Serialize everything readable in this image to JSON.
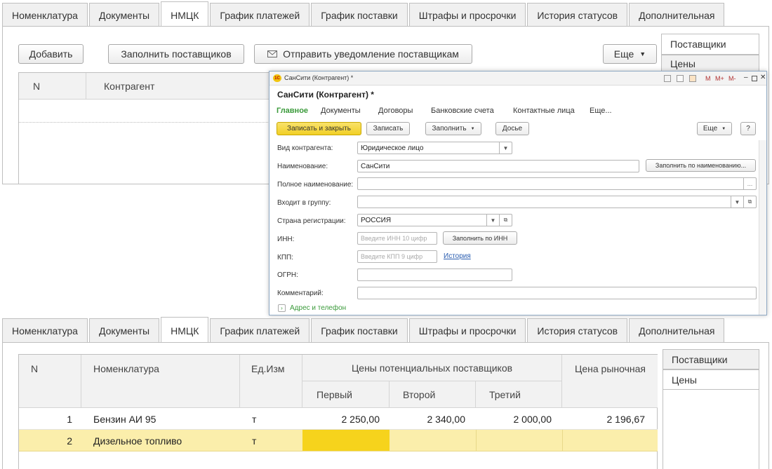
{
  "tabs": [
    "Номенклатура",
    "Документы",
    "НМЦК",
    "График платежей",
    "График поставки",
    "Штрафы и просрочки",
    "История статусов",
    "Дополнительная"
  ],
  "top": {
    "buttons": {
      "add": "Добавить",
      "fill_suppliers": "Заполнить поставщиков",
      "notify": "Отправить уведомление поставщикам",
      "more": "Еще"
    },
    "side_tabs": [
      "Поставщики",
      "Цены"
    ],
    "columns": [
      "N",
      "Контрагент"
    ]
  },
  "dialog": {
    "titlebar": "СанСити (Контрагент) *",
    "titlebar_controls": [
      "M",
      "M+",
      "M-"
    ],
    "heading": "СанСити (Контрагент) *",
    "nav": [
      "Главное",
      "Документы",
      "Договоры",
      "Банковские счета",
      "Контактные лица",
      "Еще..."
    ],
    "toolbar": {
      "save_close": "Записать и закрыть",
      "save": "Записать",
      "fill": "Заполнить",
      "dossier": "Досье",
      "more": "Еще",
      "help": "?"
    },
    "fields": {
      "kind_label": "Вид контрагента:",
      "kind_value": "Юридическое лицо",
      "name_label": "Наименование:",
      "name_value": "СанСити",
      "fill_by_name": "Заполнить по наименованию...",
      "fullname_label": "Полное наименование:",
      "group_label": "Входит в группу:",
      "country_label": "Страна регистрации:",
      "country_value": "РОССИЯ",
      "inn_label": "ИНН:",
      "inn_placeholder": "Введите ИНН 10 цифр",
      "fill_by_inn": "Заполнить по ИНН",
      "kpp_label": "КПП:",
      "kpp_placeholder": "Введите КПП 9 цифр",
      "history": "История",
      "ogrn_label": "ОГРН:",
      "comment_label": "Комментарий:",
      "address": "Адрес и телефон"
    }
  },
  "bottom": {
    "side_tabs": [
      "Поставщики",
      "Цены"
    ],
    "headers": {
      "n": "N",
      "item": "Номенклатура",
      "unit": "Ед.Изм",
      "group": "Цены потенциальных поставщиков",
      "first": "Первый",
      "second": "Второй",
      "third": "Третий",
      "market": "Цена рыночная"
    },
    "rows": [
      {
        "n": "1",
        "item": "Бензин АИ 95",
        "unit": "т",
        "first": "2 250,00",
        "second": "2 340,00",
        "third": "2 000,00",
        "market": "2 196,67"
      },
      {
        "n": "2",
        "item": "Дизельное топливо",
        "unit": "т",
        "first": "",
        "second": "",
        "third": "",
        "market": ""
      }
    ]
  },
  "colors": {
    "selected_row": "#fbeeab",
    "active_cell": "#f6d31c",
    "accent_green": "#3a9a3a",
    "primary_button": "#f4d530"
  }
}
